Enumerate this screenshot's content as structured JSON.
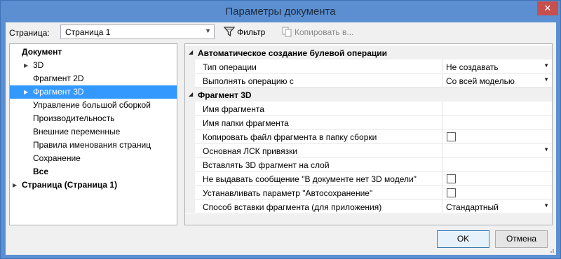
{
  "window": {
    "title": "Параметры документа",
    "close_label": "✕"
  },
  "toolbar": {
    "page_label": "Страница:",
    "page_value": "Страница 1",
    "filter_label": "Фильтр",
    "copy_label": "Копировать в..."
  },
  "tree": {
    "items": [
      {
        "label": "Документ"
      },
      {
        "label": "3D"
      },
      {
        "label": "Фрагмент 2D"
      },
      {
        "label": "Фрагмент 3D"
      },
      {
        "label": "Управление большой сборкой"
      },
      {
        "label": "Производительность"
      },
      {
        "label": "Внешние переменные"
      },
      {
        "label": "Правила именования страниц"
      },
      {
        "label": "Сохранение"
      },
      {
        "label": "Все"
      },
      {
        "label": "Страница (Страница 1)"
      }
    ]
  },
  "properties": {
    "rows": [
      {
        "name": "Автоматическое создание булевой операции",
        "value": ""
      },
      {
        "name": "Тип операции",
        "value": "Не создавать"
      },
      {
        "name": "Выполнять операцию с",
        "value": "Со всей моделью"
      },
      {
        "name": "Фрагмент 3D",
        "value": ""
      },
      {
        "name": "Имя фрагмента",
        "value": ""
      },
      {
        "name": "Имя папки фрагмента",
        "value": ""
      },
      {
        "name": "Копировать файл фрагмента в папку сборки",
        "value": "",
        "checked": false
      },
      {
        "name": "Основная ЛСК привязки",
        "value": ""
      },
      {
        "name": "Вставлять 3D фрагмент на слой",
        "value": ""
      },
      {
        "name": "Не выдавать сообщение \"В документе нет 3D модели\"",
        "value": "",
        "checked": false
      },
      {
        "name": "Устанавливать параметр \"Автосохранение\"",
        "value": "",
        "checked": false
      },
      {
        "name": "Способ вставки фрагмента (для приложения)",
        "value": "Стандартный"
      }
    ]
  },
  "buttons": {
    "ok": "OK",
    "cancel": "Отмена"
  },
  "colors": {
    "title_bar": "#5b8fd1",
    "selection": "#3399ff",
    "close": "#c74f4d"
  }
}
